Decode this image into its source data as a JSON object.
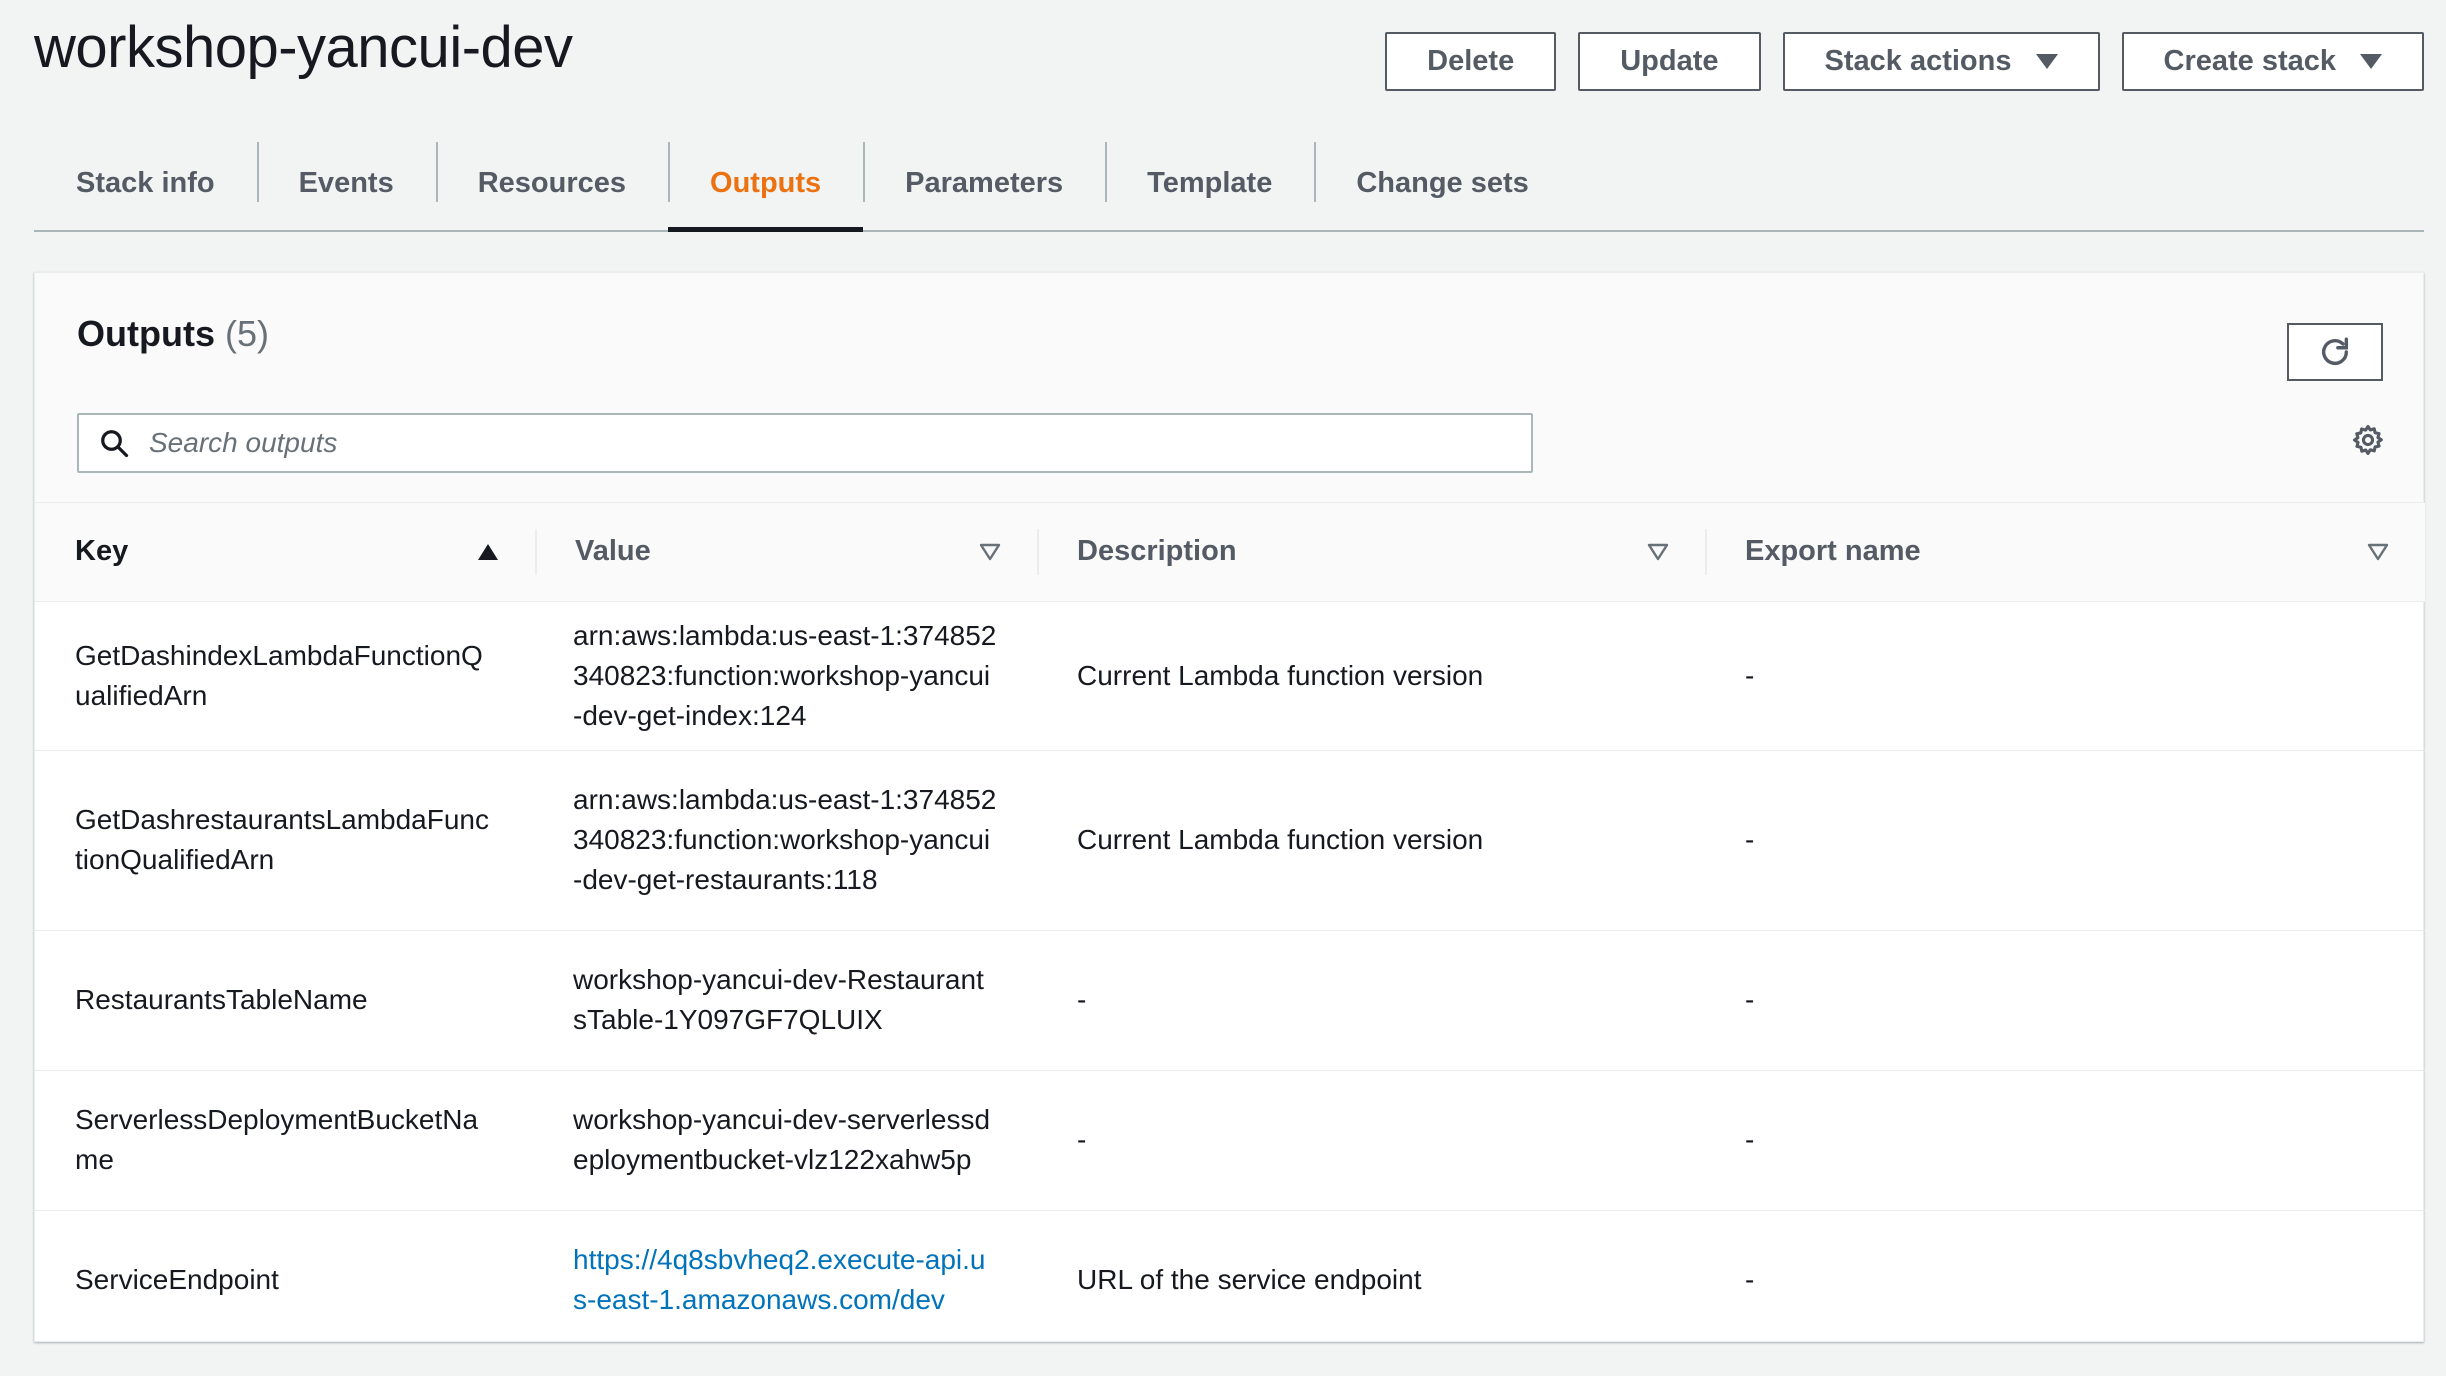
{
  "stack": {
    "name": "workshop-yancui-dev"
  },
  "actions": {
    "delete": "Delete",
    "update": "Update",
    "stack_actions": "Stack actions",
    "create_stack": "Create stack"
  },
  "tabs": [
    {
      "label": "Stack info"
    },
    {
      "label": "Events"
    },
    {
      "label": "Resources"
    },
    {
      "label": "Outputs"
    },
    {
      "label": "Parameters"
    },
    {
      "label": "Template"
    },
    {
      "label": "Change sets"
    }
  ],
  "outputs": {
    "title": "Outputs",
    "count": "(5)",
    "search_placeholder": "Search outputs",
    "columns": {
      "key": "Key",
      "value": "Value",
      "description": "Description",
      "export": "Export name"
    },
    "rows": [
      {
        "key": "GetDashindexLambdaFunctionQualifiedArn",
        "value": "arn:aws:lambda:us-east-1:374852340823:function:workshop-yancui-dev-get-index:124",
        "description": "Current Lambda function version",
        "export": "-"
      },
      {
        "key": "GetDashrestaurantsLambdaFunctionQualifiedArn",
        "value": "arn:aws:lambda:us-east-1:374852340823:function:workshop-yancui-dev-get-restaurants:118",
        "description": "Current Lambda function version",
        "export": "-"
      },
      {
        "key": "RestaurantsTableName",
        "value": "workshop-yancui-dev-RestaurantsTable-1Y097GF7QLUIX",
        "description": "-",
        "export": "-"
      },
      {
        "key": "ServerlessDeploymentBucketName",
        "value": "workshop-yancui-dev-serverlessdeploymentbucket-vlz122xahw5p",
        "description": "-",
        "export": "-"
      },
      {
        "key": "ServiceEndpoint",
        "value": "https://4q8sbvheq2.execute-api.us-east-1.amazonaws.com/dev",
        "description": "URL of the service endpoint",
        "export": "-"
      }
    ]
  },
  "colors": {
    "accent": "#ec7211",
    "link": "#0073bb",
    "text": "#16191f",
    "muted": "#545b64"
  }
}
